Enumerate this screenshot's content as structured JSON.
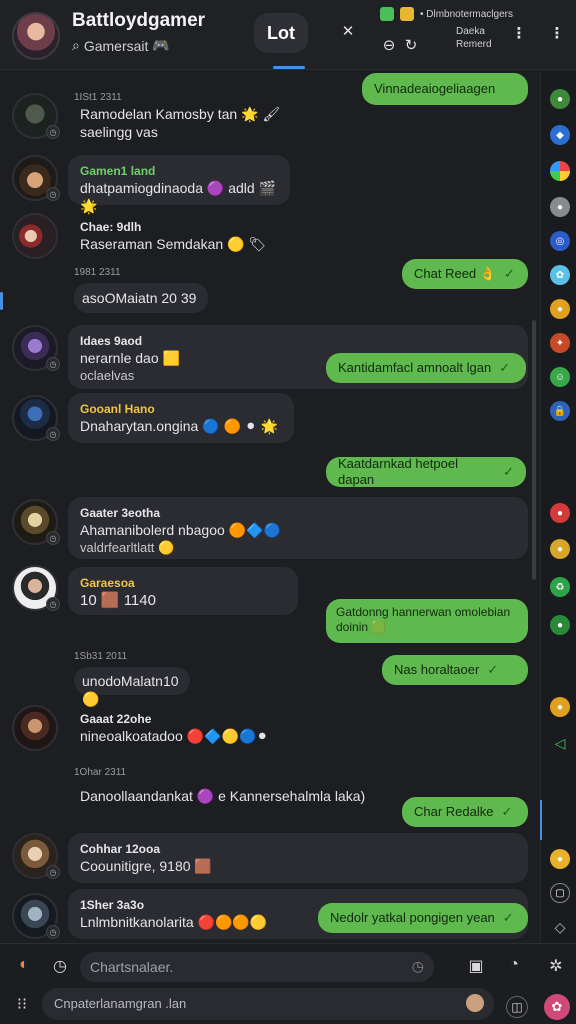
{
  "header": {
    "title": "Battloydgamer",
    "subtitle": "Gamersait",
    "subtitle_emoji": "🎮",
    "pill_label": "Lot",
    "status_text": "• Dlmbnotermaclgers",
    "right_line1": "Daeka",
    "right_line2": "Remerd"
  },
  "messages": [
    {
      "time": "1ISt1 2311",
      "text1": "Ramodelan Kamosby tan 🌟 🖌",
      "text2": "saelingg vas"
    },
    {
      "name": "Gamen1 land",
      "text1": "dhatpamiogdinaoda 🟣 adld 🎬 🌟"
    },
    {
      "name": "Chae: 9dlh",
      "text1": "Raseraman Semdakan 🟡 🏷"
    },
    {
      "out": "Chat Reed 👌"
    },
    {
      "time": "1981 2311",
      "text1": "asoOMaiatn 20 39"
    },
    {
      "name": "Idaes 9aod",
      "text1": "nerarnle dao 🟨",
      "text2": "oclaelvas"
    },
    {
      "out": "Kantidamfacl amnoalt lgan"
    },
    {
      "name": "Gooanl Hano",
      "text1": "Dnaharytan.ongina 🔵 🟠 ⚫ 🌟"
    },
    {
      "out": "Kaatdarnkad hetpoel dapan"
    },
    {
      "name": "Gaater 3eotha",
      "text1": "Ahamanibolerd nbagoo 🟠🔷🔵",
      "text2": "valdrfearltlatt 🟡"
    },
    {
      "name": "Garaesoa",
      "text1": "10 🟫 1140"
    },
    {
      "out1": "Gatdonng hannerwan omolebian",
      "out2": "doinin 🟩"
    },
    {
      "time": "1Sb31 2011",
      "text1": "unodoMalatn10 🟡"
    },
    {
      "out": "Nas horaltaoer"
    },
    {
      "name": "Gaaat 22ohe",
      "text1": "nineoalkoatadoo 🔴🔷🟡🔵⚫"
    },
    {
      "time": "1Ohar 2311",
      "text1": "Danoollaandankat 🟣 e Kannersehalmla laka)"
    },
    {
      "out": "Char Redalke"
    },
    {
      "name": "Cohhar 12ooa",
      "text1": "Coounitigre, 9180 🟫"
    },
    {
      "name": "1Sher 3a3o",
      "text1": "Lnlmbnitkanolarita 🔴🟠🟠🟡"
    },
    {
      "out": "Nedolr yatkal pongigen yean"
    }
  ],
  "composer": {
    "placeholder1": "Chartsnalaer.",
    "placeholder2": "Cnpaterlanamgran .lan"
  },
  "colors": {
    "accent": "#4a8fe0",
    "outgoing": "#5fb94f",
    "incoming": "#2b2c31",
    "background": "#1d1e22"
  }
}
